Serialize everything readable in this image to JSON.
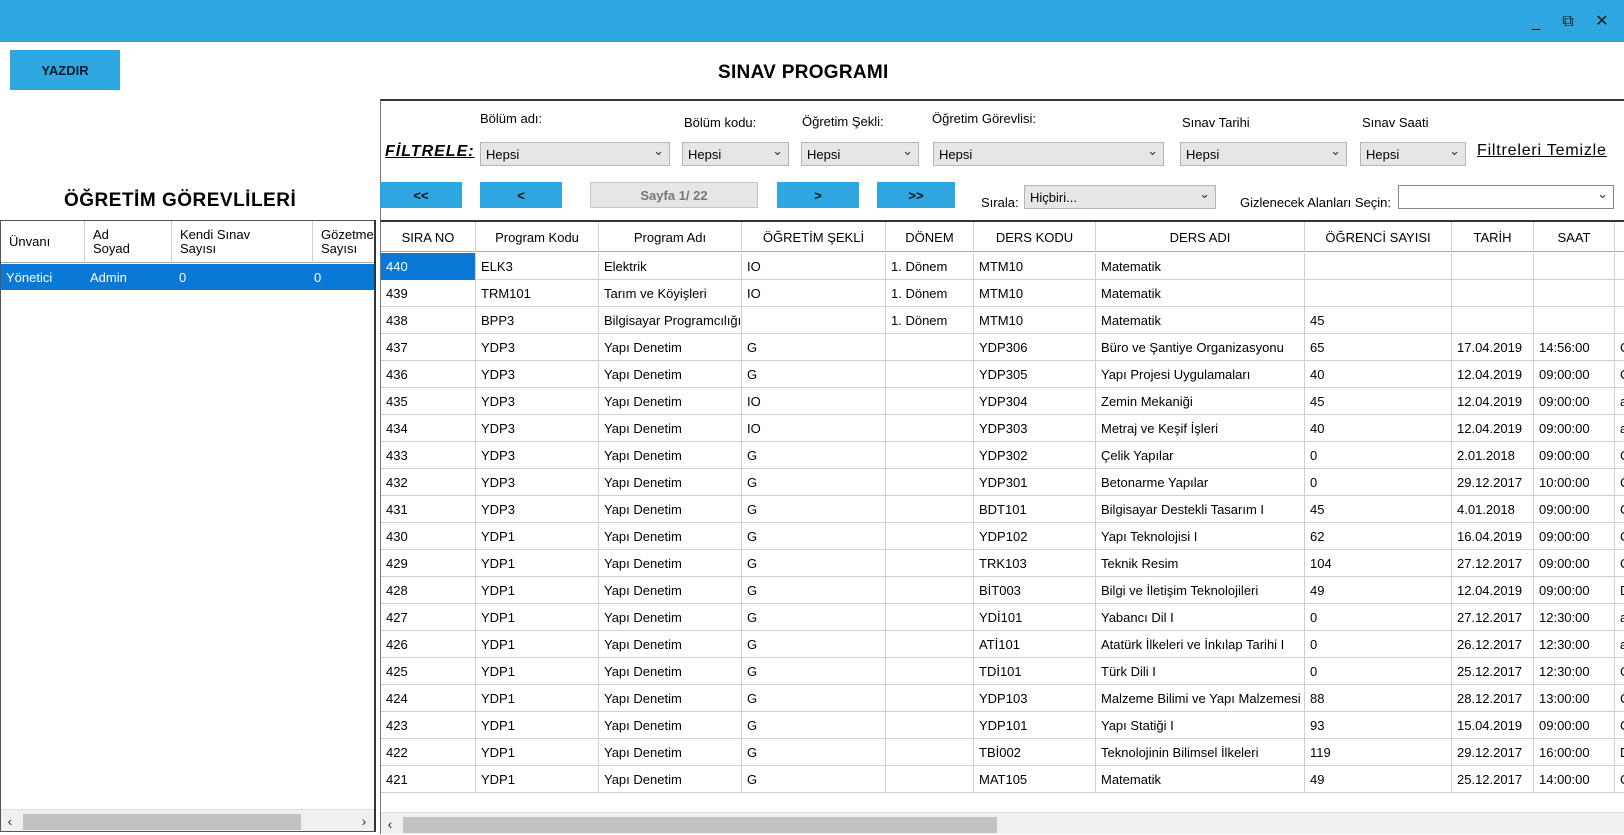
{
  "window": {
    "min_icon": "minimize-icon",
    "restore_icon": "restore-icon",
    "close_icon": "close-icon",
    "min_glyph": "_",
    "restore_glyph": "⧉",
    "close_glyph": "✕"
  },
  "toolbar": {
    "print_label": "YAZDIR"
  },
  "title": "SINAV PROGRAMI",
  "left": {
    "title": "ÖĞRETİM GÖREVLİLERİ",
    "columns": [
      "Ünvanı",
      "Ad\nSoyad",
      "Kendi Sınav\nSayısı",
      "Gözetmen\nSayısı"
    ],
    "rows": [
      [
        "Yönetici",
        "Admin",
        "0",
        "0"
      ]
    ]
  },
  "filters": {
    "filter_label": "FİLTRELE:",
    "clear_label": "Filtreleri Temizle",
    "bolum_adi": {
      "label": "Bölüm adı:",
      "value": "Hepsi"
    },
    "bolum_kodu": {
      "label": "Bölüm kodu:",
      "value": "Hepsi"
    },
    "ogretim_sekli": {
      "label": "Öğretim Şekli:",
      "value": "Hepsi"
    },
    "ogretim_gorevlisi": {
      "label": "Öğretim Görevlisi:",
      "value": "Hepsi"
    },
    "sinav_tarihi": {
      "label": "Sınav Tarihi",
      "value": "Hepsi"
    },
    "sinav_saati": {
      "label": "Sınav Saati",
      "value": "Hepsi"
    }
  },
  "pager": {
    "first": "<<",
    "prev": "<",
    "page": "Sayfa 1/ 22",
    "next": ">",
    "last": ">>",
    "sort_label": "Sırala:",
    "sort_value": "Hiçbiri...",
    "hide_label": "Gizlenecek Alanları Seçin:",
    "hide_value": ""
  },
  "grid": {
    "columns": [
      "SIRA NO",
      "Program Kodu",
      "Program Adı",
      "ÖĞRETİM ŞEKLİ",
      "DÖNEM",
      "DERS KODU",
      "DERS ADI",
      "ÖĞRENCİ SAYISI",
      "TARİH",
      "SAAT",
      ""
    ],
    "rows": [
      [
        "440",
        "ELK3",
        "Elektrik",
        "IO",
        "1. Dönem",
        "MTM10",
        "Matematik",
        "",
        "",
        "",
        ""
      ],
      [
        "439",
        "TRM101",
        "Tarım ve Köyişleri",
        "IO",
        "1. Dönem",
        "MTM10",
        "Matematik",
        "",
        "",
        "",
        ""
      ],
      [
        "438",
        "BPP3",
        "Bilgisayar Programcılığı",
        "",
        "1. Dönem",
        "MTM10",
        "Matematik",
        "45",
        "",
        "",
        ""
      ],
      [
        "437",
        "YDP3",
        "Yapı Denetim",
        "G",
        "",
        "YDP306",
        "Büro ve Şantiye Organizasyonu",
        "65",
        "17.04.2019",
        "14:56:00",
        "C"
      ],
      [
        "436",
        "YDP3",
        "Yapı Denetim",
        "G",
        "",
        "YDP305",
        "Yapı Projesi Uygulamaları",
        "40",
        "12.04.2019",
        "09:00:00",
        "C"
      ],
      [
        "435",
        "YDP3",
        "Yapı Denetim",
        "IO",
        "",
        "YDP304",
        "Zemin Mekaniği",
        "45",
        "12.04.2019",
        "09:00:00",
        "a"
      ],
      [
        "434",
        "YDP3",
        "Yapı Denetim",
        "IO",
        "",
        "YDP303",
        "Metraj ve Keşif İşleri",
        "40",
        "12.04.2019",
        "09:00:00",
        "a"
      ],
      [
        "433",
        "YDP3",
        "Yapı Denetim",
        "G",
        "",
        "YDP302",
        "Çelik Yapılar",
        "0",
        "2.01.2018",
        "09:00:00",
        "C"
      ],
      [
        "432",
        "YDP3",
        "Yapı Denetim",
        "G",
        "",
        "YDP301",
        "Betonarme Yapılar",
        "0",
        "29.12.2017",
        "10:00:00",
        "C"
      ],
      [
        "431",
        "YDP3",
        "Yapı Denetim",
        "G",
        "",
        "BDT101",
        "Bilgisayar Destekli Tasarım I",
        "45",
        "4.01.2018",
        "09:00:00",
        "C"
      ],
      [
        "430",
        "YDP1",
        "Yapı Denetim",
        "G",
        "",
        "YDP102",
        "Yapı Teknolojisi I",
        "62",
        "16.04.2019",
        "09:00:00",
        "C"
      ],
      [
        "429",
        "YDP1",
        "Yapı Denetim",
        "G",
        "",
        "TRK103",
        "Teknik Resim",
        "104",
        "27.12.2017",
        "09:00:00",
        "C"
      ],
      [
        "428",
        "YDP1",
        "Yapı Denetim",
        "G",
        "",
        "BİT003",
        "Bilgi ve İletişim Teknolojileri",
        "49",
        "12.04.2019",
        "09:00:00",
        "D"
      ],
      [
        "427",
        "YDP1",
        "Yapı Denetim",
        "G",
        "",
        "YDİ101",
        "Yabancı Dil I",
        "0",
        "27.12.2017",
        "12:30:00",
        "a"
      ],
      [
        "426",
        "YDP1",
        "Yapı Denetim",
        "G",
        "",
        "ATİ101",
        "Atatürk İlkeleri ve İnkılap Tarihi I",
        "0",
        "26.12.2017",
        "12:30:00",
        "a"
      ],
      [
        "425",
        "YDP1",
        "Yapı Denetim",
        "G",
        "",
        "TDİ101",
        "Türk Dili I",
        "0",
        "25.12.2017",
        "12:30:00",
        "C"
      ],
      [
        "424",
        "YDP1",
        "Yapı Denetim",
        "G",
        "",
        "YDP103",
        "Malzeme Bilimi ve Yapı Malzemesi",
        "88",
        "28.12.2017",
        "13:00:00",
        "C"
      ],
      [
        "423",
        "YDP1",
        "Yapı Denetim",
        "G",
        "",
        "YDP101",
        "Yapı Statiği I",
        "93",
        "15.04.2019",
        "09:00:00",
        "C"
      ],
      [
        "422",
        "YDP1",
        "Yapı Denetim",
        "G",
        "",
        "TBİ002",
        "Teknolojinin Bilimsel İlkeleri",
        "119",
        "29.12.2017",
        "16:00:00",
        "D"
      ],
      [
        "421",
        "YDP1",
        "Yapı Denetim",
        "G",
        "",
        "MAT105",
        "Matematik",
        "49",
        "25.12.2017",
        "14:00:00",
        "C"
      ]
    ]
  },
  "colors": {
    "accent": "#2ea7e0",
    "selection": "#0a78d7"
  }
}
